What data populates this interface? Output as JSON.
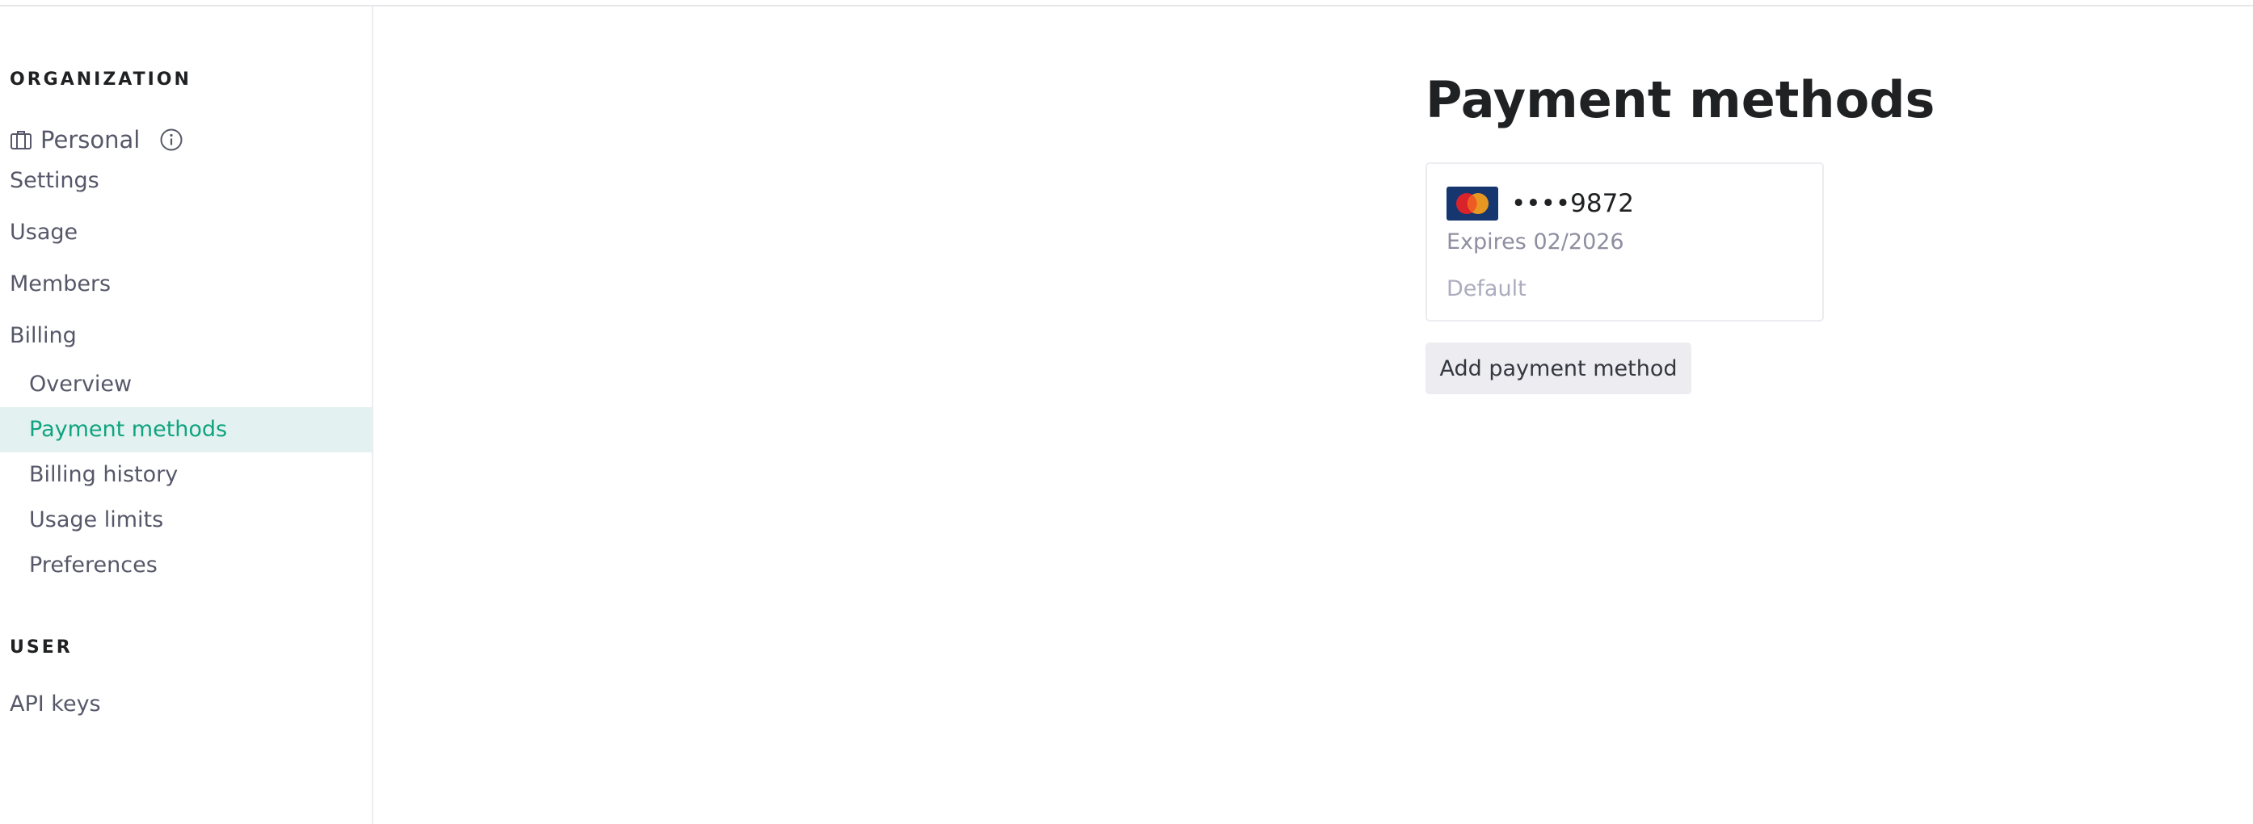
{
  "sidebar": {
    "organization_heading": "ORGANIZATION",
    "org": {
      "name": "Personal",
      "icon": "briefcase-icon",
      "info_icon": "info-icon"
    },
    "nav": {
      "settings": "Settings",
      "usage": "Usage",
      "members": "Members",
      "billing": "Billing"
    },
    "billing_items": {
      "overview": "Overview",
      "payment_methods": "Payment methods",
      "billing_history": "Billing history",
      "usage_limits": "Usage limits",
      "preferences": "Preferences"
    },
    "active_item": "Payment methods",
    "user_heading": "USER",
    "user_nav": {
      "api_keys": "API keys"
    }
  },
  "main": {
    "title": "Payment methods",
    "cards": [
      {
        "brand": "mastercard-icon",
        "number": "••••9872",
        "expires": "Expires 02/2026",
        "status": "Default"
      }
    ],
    "add_button_label": "Add payment method"
  },
  "colors": {
    "accent": "#10a37f",
    "active_bg": "#e3f2f1",
    "button_bg": "#ececf1",
    "border": "#ececf1"
  }
}
